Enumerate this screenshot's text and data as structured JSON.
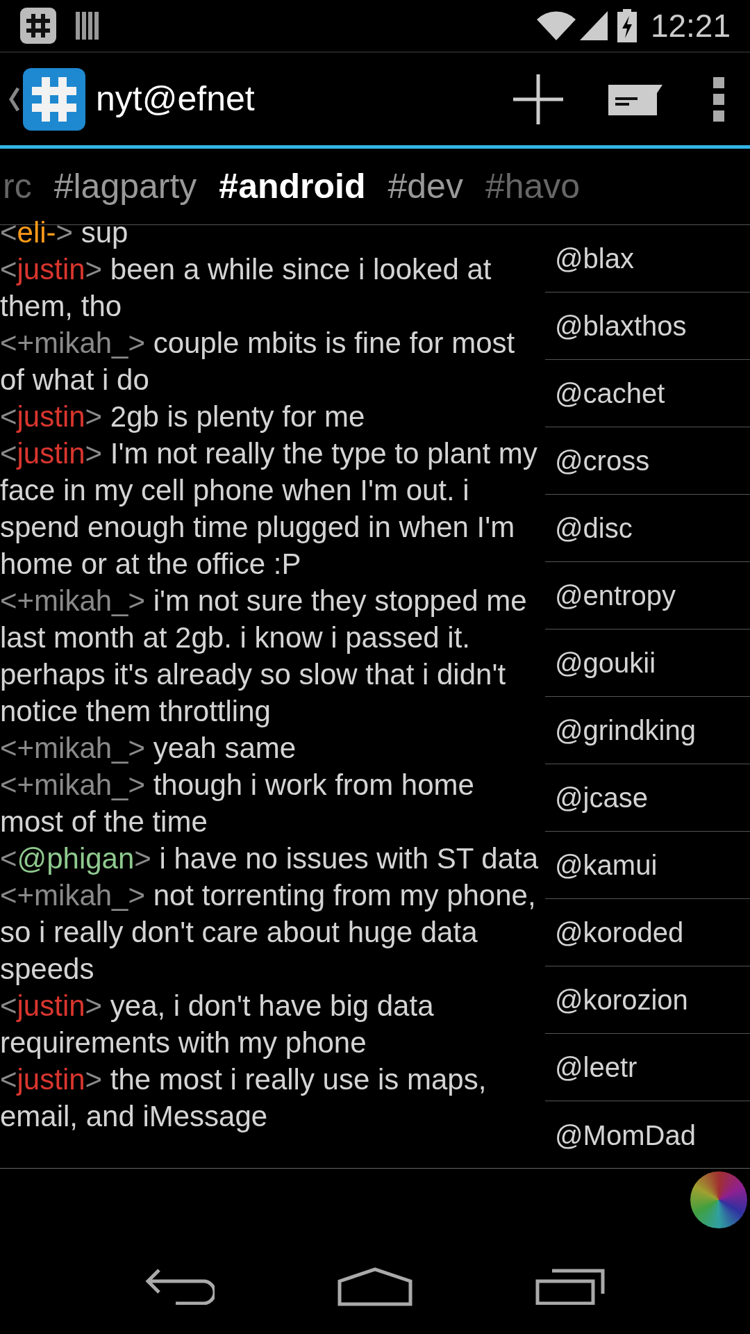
{
  "status_bar": {
    "time": "12:21"
  },
  "action_bar": {
    "title": "nyt@efnet"
  },
  "tabs": [
    {
      "label": "rc",
      "selected": false
    },
    {
      "label": "#lagparty",
      "selected": false
    },
    {
      "label": "#android",
      "selected": true
    },
    {
      "label": "#dev",
      "selected": false
    },
    {
      "label": "#havo",
      "selected": false
    }
  ],
  "messages": [
    {
      "open": "<",
      "nick": "eli-",
      "close": ">",
      "color": "#ff9a1a",
      "text": "sup"
    },
    {
      "open": "<",
      "nick": "justin",
      "close": ">",
      "color": "#d9362e",
      "text": "been a while since i looked at them, tho"
    },
    {
      "open": "<",
      "nick": "+mikah_",
      "close": ">",
      "color": "#8a8a8a",
      "text": "couple mbits is fine for most of what i do"
    },
    {
      "open": "<",
      "nick": "justin",
      "close": ">",
      "color": "#d9362e",
      "text": "2gb is plenty for me"
    },
    {
      "open": "<",
      "nick": "justin",
      "close": ">",
      "color": "#d9362e",
      "text": "I'm not really the type to plant my face in my cell phone when I'm out. i  spend enough time plugged in when I'm home or at the office :P"
    },
    {
      "open": "<",
      "nick": "+mikah_",
      "close": ">",
      "color": "#8a8a8a",
      "text": "i'm not sure they stopped me last month at 2gb. i know i passed it. perhaps it's already so slow that i didn't notice them throttling"
    },
    {
      "open": "<",
      "nick": "+mikah_",
      "close": ">",
      "color": "#8a8a8a",
      "text": "yeah same"
    },
    {
      "open": "<",
      "nick": "+mikah_",
      "close": ">",
      "color": "#8a8a8a",
      "text": "though i work from home most of the time"
    },
    {
      "open": "<",
      "nick": "@phigan",
      "close": ">",
      "color": "#8fc98f",
      "text": "i have no issues with ST data"
    },
    {
      "open": "<",
      "nick": "+mikah_",
      "close": ">",
      "color": "#8a8a8a",
      "text": "not torrenting from my phone, so i really don't care about huge data speeds"
    },
    {
      "open": "<",
      "nick": "justin",
      "close": ">",
      "color": "#d9362e",
      "text": "yea, i don't have big data requirements with my phone"
    },
    {
      "open": "<",
      "nick": "justin",
      "close": ">",
      "color": "#d9362e",
      "text": "the most i really use is maps, email, and iMessage"
    }
  ],
  "nick_list": [
    "@blax",
    "@blaxthos",
    "@cachet",
    "@cross",
    "@disc",
    "@entropy",
    "@goukii",
    "@grindking",
    "@jcase",
    "@kamui",
    "@koroded",
    "@korozion",
    "@leetr",
    "@MomDad"
  ]
}
